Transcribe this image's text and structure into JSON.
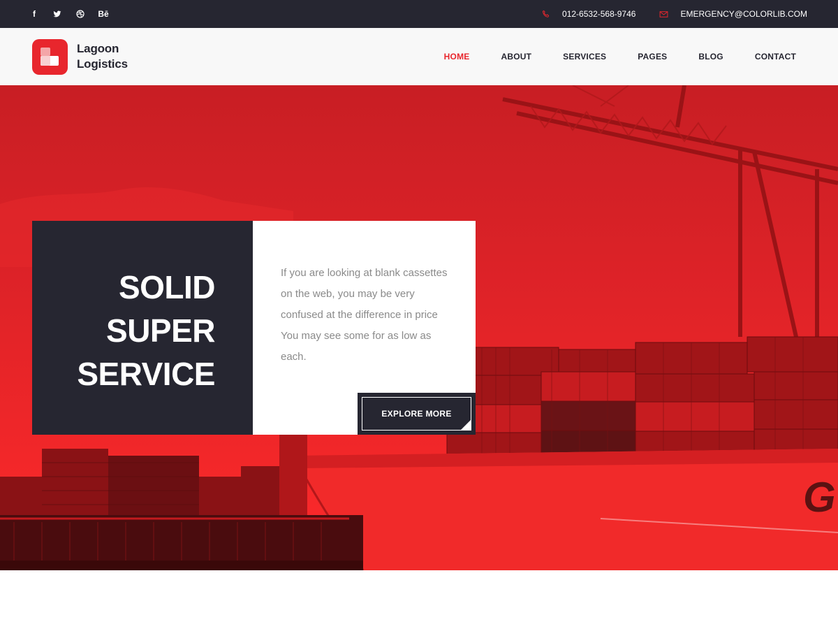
{
  "topbar": {
    "social": [
      {
        "name": "facebook-icon",
        "glyph": "f"
      },
      {
        "name": "twitter-icon",
        "glyph": ""
      },
      {
        "name": "dribbble-icon",
        "glyph": ""
      },
      {
        "name": "behance-icon",
        "glyph": "Bē"
      }
    ],
    "phone": "012-6532-568-9746",
    "email": "EMERGENCY@COLORLIB.COM"
  },
  "header": {
    "brand_line1": "Lagoon",
    "brand_line2": "Logistics",
    "nav": [
      "HOME",
      "ABOUT",
      "SERVICES",
      "PAGES",
      "BLOG",
      "CONTACT"
    ],
    "active_nav": "HOME"
  },
  "hero": {
    "heading_lines": [
      "SOLID",
      "SUPER",
      "SERVICE"
    ],
    "description": "If you are looking at blank cassettes on the web, you may be very confused at the difference in price You may see some for as low as each.",
    "button": "EXPLORE MORE"
  },
  "colors": {
    "accent": "#e8262d",
    "dark": "#262631",
    "header_bg": "#f8f8f8",
    "hero_red": "#d81e23"
  }
}
